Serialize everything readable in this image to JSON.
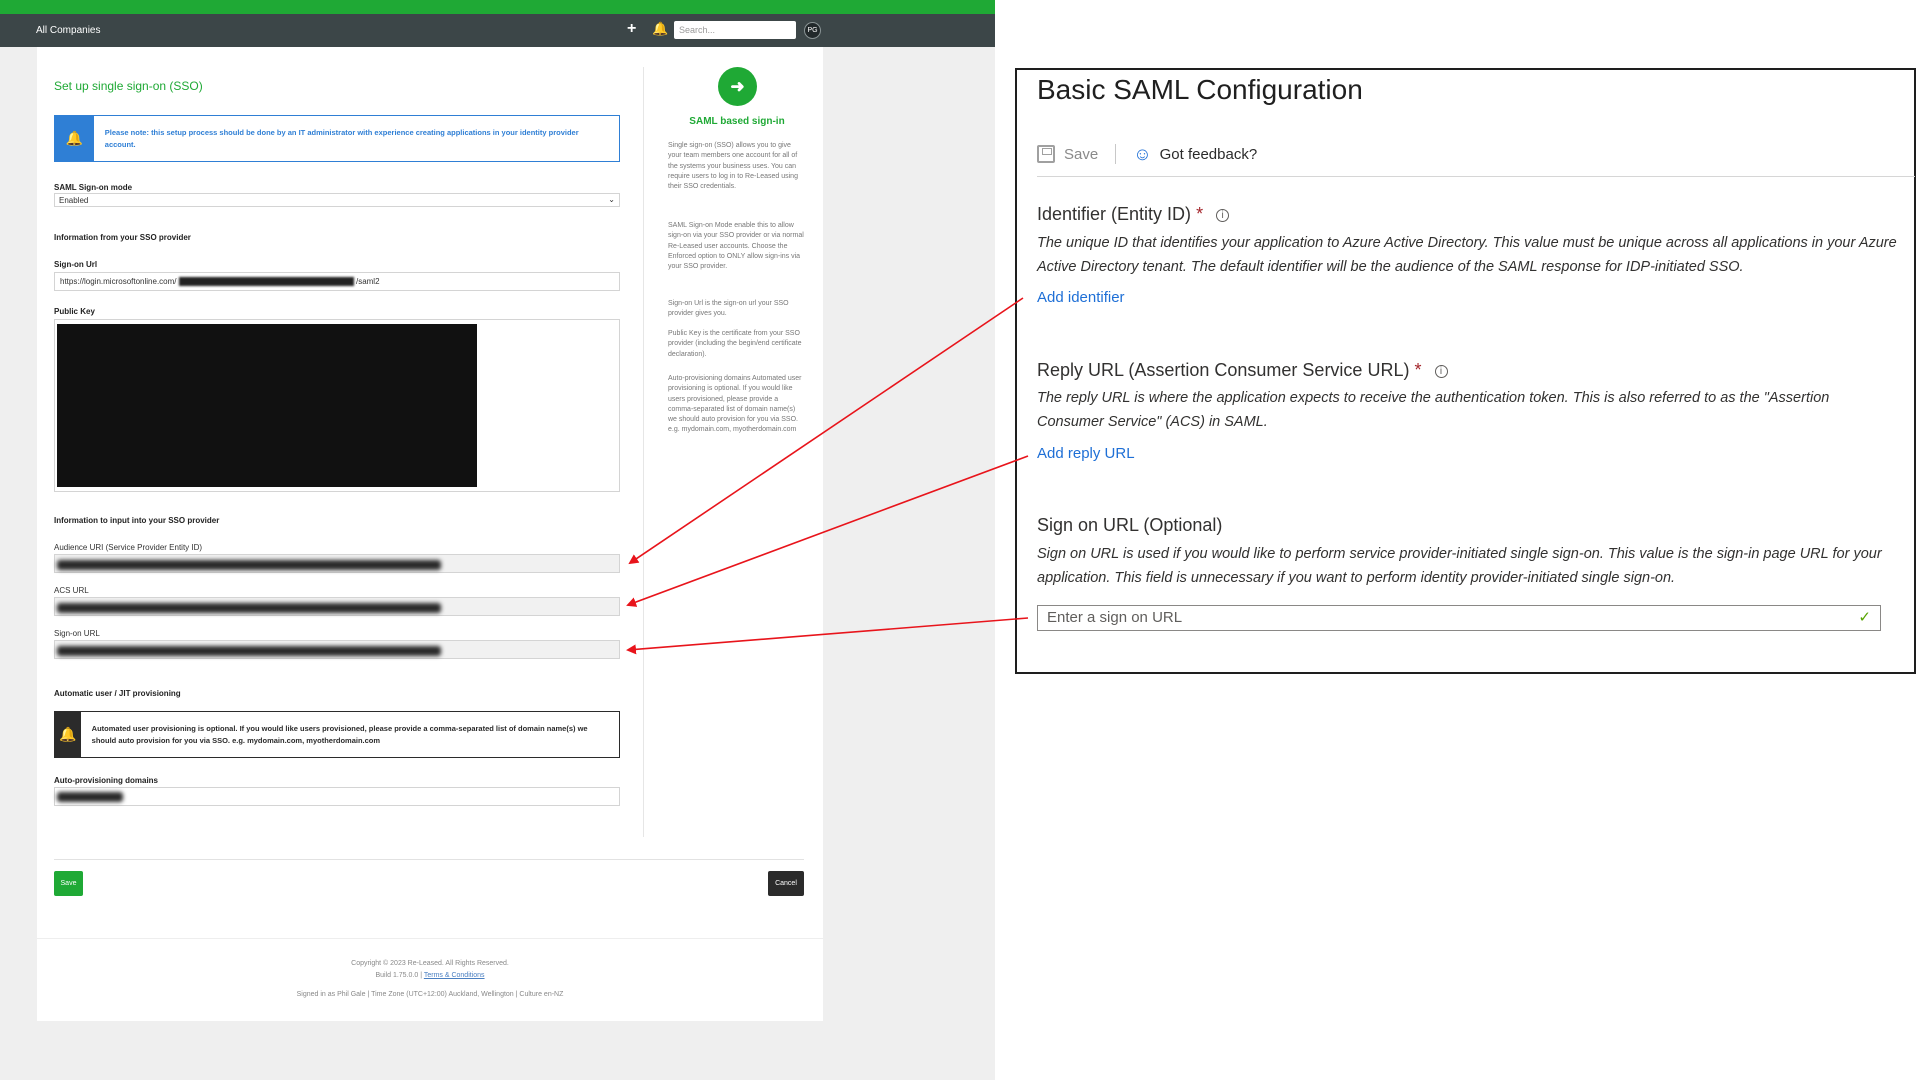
{
  "left_app": {
    "topbar": {
      "company": "All Companies",
      "search_placeholder": "Search...",
      "avatar_initials": "PG"
    },
    "page_title": "Set up single sign-on (SSO)",
    "notice_admin": "Please note: this setup process should be done by an IT administrator with experience creating applications in your identity provider account.",
    "saml_mode_label": "SAML Sign-on mode",
    "saml_mode_value": "Enabled",
    "section_from_provider": "Information from your SSO provider",
    "signon_url_label": "Sign-on Url",
    "signon_url_prefix": "https://login.microsoftonline.com/",
    "signon_url_suffix": "/saml2",
    "public_key_label": "Public Key",
    "section_to_provider": "Information to input into your SSO provider",
    "audience_uri_label": "Audience URI (Service Provider Entity ID)",
    "acs_url_label": "ACS URL",
    "signon_url_label2": "Sign-on URL",
    "section_provisioning": "Automatic user / JIT provisioning",
    "notice_provisioning": "Automated user provisioning is optional. If you would like users provisioned, please provide a comma-separated list of domain name(s) we should auto provision for you via SSO. e.g. mydomain.com, myotherdomain.com",
    "auto_domains_label": "Auto-provisioning domains",
    "save_label": "Save",
    "cancel_label": "Cancel",
    "sidebar": {
      "heading": "SAML based sign-in",
      "p1": "Single sign-on (SSO) allows you to give your team members one account for all of the systems your business uses. You can require users to log in to Re-Leased using their SSO credentials.",
      "p2": "SAML Sign-on Mode enable this to allow sign-on via your SSO provider or via normal Re-Leased user accounts. Choose the Enforced option to ONLY allow sign-ins via your SSO provider.",
      "p3": "Sign-on Url is the sign-on url your SSO provider gives you.",
      "p4": "Public Key is the certificate from your SSO provider (including the begin/end certificate declaration).",
      "p5": "Auto-provisioning domains Automated user provisioning is optional. If you would like users provisioned, please provide a comma-separated list of domain name(s) we should auto provision for you via SSO. e.g. mydomain.com, myotherdomain.com"
    },
    "footer": {
      "copyright": "Copyright © 2023 Re-Leased. All Rights Reserved.",
      "build": "Build 1.75.0.0",
      "terms": "Terms & Conditions",
      "signed_in": "Signed in as Phil Gale",
      "timezone": "Time Zone (UTC+12:00) Auckland, Wellington",
      "culture": "Culture en-NZ"
    }
  },
  "azure": {
    "title": "Basic SAML Configuration",
    "save_label": "Save",
    "feedback_label": "Got feedback?",
    "identifier_heading": "Identifier (Entity ID)",
    "identifier_desc": "The unique ID that identifies your application to Azure Active Directory. This value must be unique across all applications in your Azure Active Directory tenant. The default identifier will be the audience of the SAML response for IDP-initiated SSO.",
    "add_identifier": "Add identifier",
    "reply_heading": "Reply URL (Assertion Consumer Service URL)",
    "reply_desc": "The reply URL is where the application expects to receive the authentication token. This is also referred to as the \"Assertion Consumer Service\" (ACS) in SAML.",
    "add_reply": "Add reply URL",
    "signon_heading": "Sign on URL (Optional)",
    "signon_desc": "Sign on URL is used if you would like to perform service provider-initiated single sign-on. This value is the sign-in page URL for your application. This field is unnecessary if you want to perform identity provider-initiated single sign-on.",
    "signon_placeholder": "Enter a sign on URL",
    "required_mark": "*",
    "info_mark": "i"
  },
  "colors": {
    "brand_green": "#1fa935",
    "azure_link": "#1e6fd6",
    "arrow_red": "#e8141b"
  }
}
